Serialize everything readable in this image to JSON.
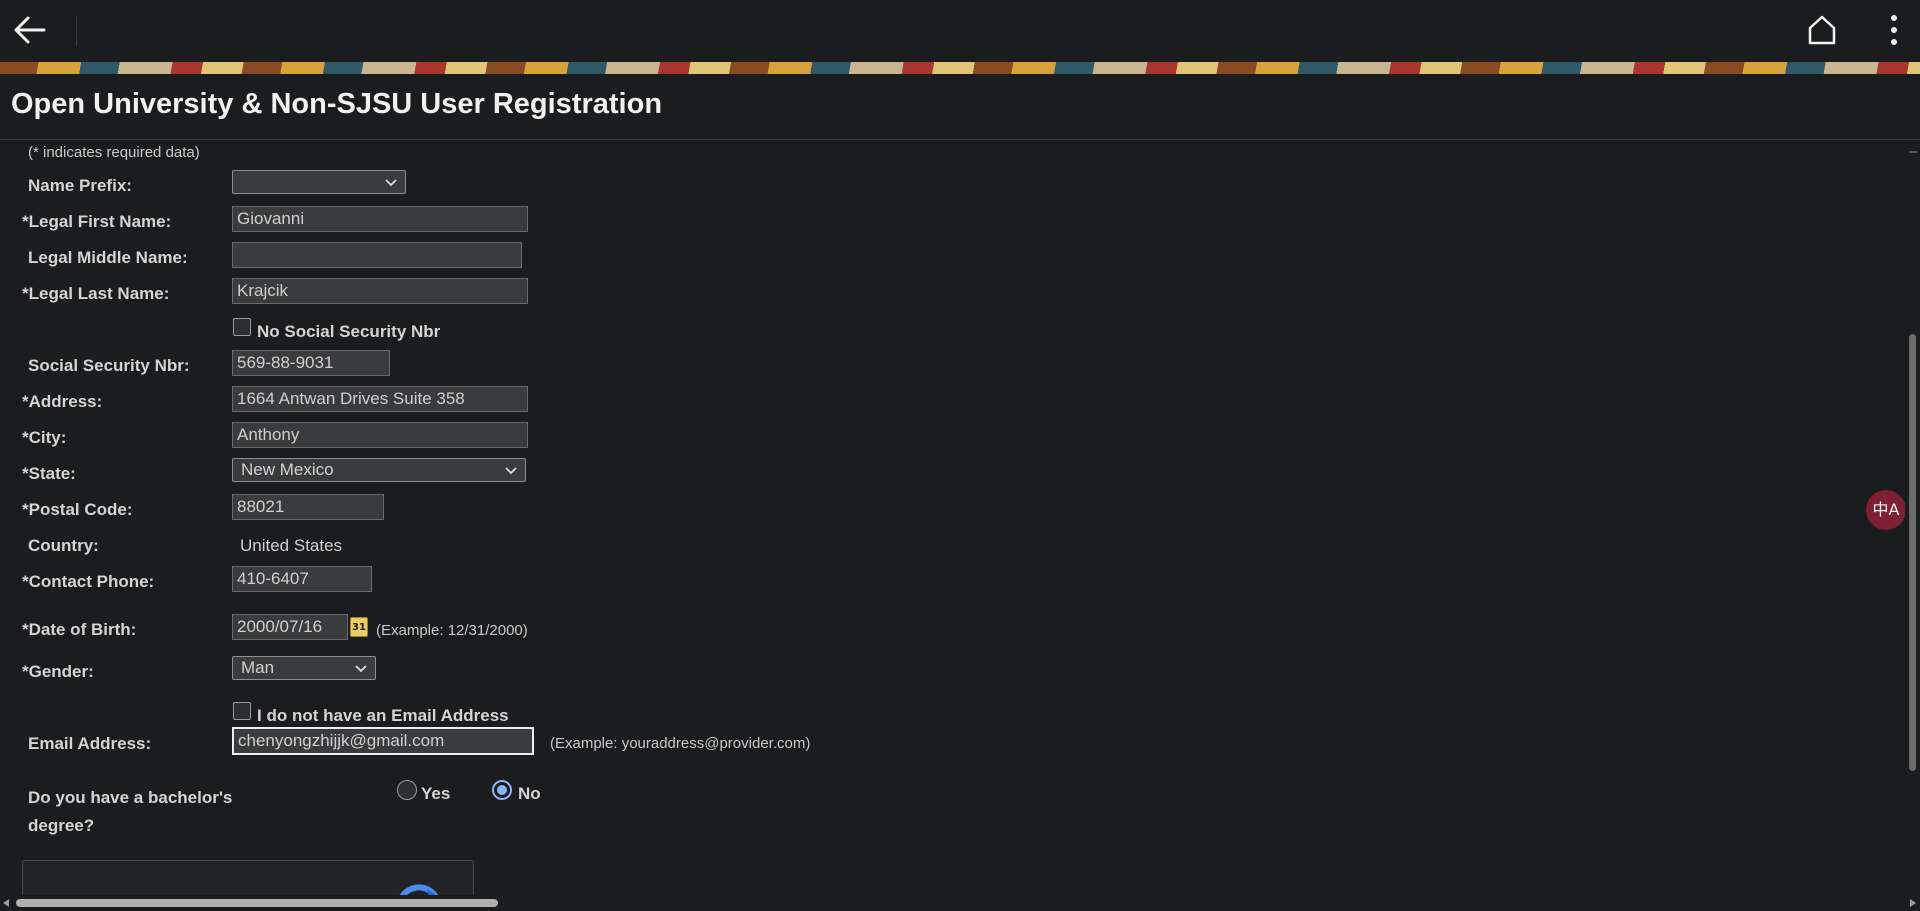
{
  "page": {
    "title": "Open University & Non-SJSU User Registration",
    "required_note": "(* indicates required data)"
  },
  "theme": {
    "accent": "#8ab4f8",
    "fab": "#7d2031"
  },
  "nav": {
    "back_icon": "arrow-left-icon",
    "home_icon": "home-icon",
    "more_icon": "more-vertical-icon"
  },
  "form": {
    "name_prefix": {
      "label": "Name Prefix:",
      "value": ""
    },
    "first_name": {
      "label": "*Legal First Name:",
      "value": "Giovanni"
    },
    "middle_name": {
      "label": "Legal Middle Name:",
      "value": ""
    },
    "last_name": {
      "label": "*Legal Last Name:",
      "value": "Krajcik"
    },
    "no_ssn": {
      "label": "No Social Security Nbr",
      "checked": false
    },
    "ssn": {
      "label": "Social Security Nbr:",
      "value": "569-88-9031"
    },
    "address": {
      "label": "*Address:",
      "value": "1664 Antwan Drives Suite 358"
    },
    "city": {
      "label": "*City:",
      "value": "Anthony"
    },
    "state": {
      "label": "*State:",
      "value": "New Mexico"
    },
    "postal_code": {
      "label": "*Postal Code:",
      "value": "88021"
    },
    "country": {
      "label": "Country:",
      "value": "United States"
    },
    "phone": {
      "label": "*Contact Phone:",
      "value": "410-6407"
    },
    "dob": {
      "label": "*Date of Birth:",
      "value": "2000/07/16",
      "example": "(Example: 12/31/2000)",
      "calendar_glyph": "31"
    },
    "gender": {
      "label": "*Gender:",
      "value": "Man"
    },
    "no_email": {
      "label": "I do not have an Email Address",
      "checked": false
    },
    "email": {
      "label": "Email Address:",
      "value": "chenyongzhijjk@gmail.com",
      "example": "(Example: youraddress@provider.com)"
    },
    "bachelor": {
      "label_line1": "Do you have a bachelor's",
      "label_line2": "degree?",
      "yes_label": "Yes",
      "no_label": "No",
      "selected": "No"
    }
  },
  "translate_fab": {
    "glyph": "中A"
  }
}
